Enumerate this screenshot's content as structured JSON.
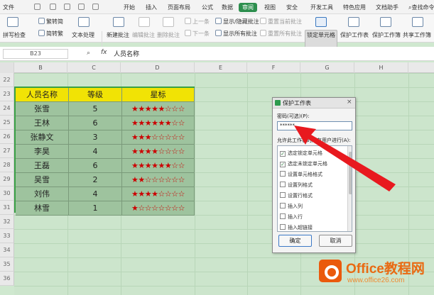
{
  "menu": {
    "items": [
      "文件",
      "开始",
      "插入",
      "页面布局",
      "公式",
      "数据",
      "审阅",
      "视图",
      "安全",
      "开发工具",
      "特色应用",
      "文档助手"
    ],
    "active": "审阅",
    "search": "查找命令",
    "file_label": "文件"
  },
  "ribbon": {
    "spellcheck": "拼写检查",
    "trad": "繁转简",
    "simp": "简转繁",
    "docproc": "文本处理",
    "new_comment": "新建批注",
    "edit_comment": "编辑批注",
    "del_comment": "删除批注",
    "prev": "上一条",
    "next": "下一条",
    "show_hide": "显示/隐藏批注",
    "show_all": "显示所有批注",
    "reset_cur": "重置当前批注",
    "reset_all": "重置所有批注",
    "lock_cell": "锁定单元格",
    "protect_sheet": "保护工作表",
    "protect_book": "保护工作簿",
    "share_book": "共享工作簿"
  },
  "formula": {
    "cellref": "B23",
    "fx": "fx",
    "value": "人员名称"
  },
  "columns": [
    "B",
    "C",
    "D",
    "E",
    "F",
    "G",
    "H"
  ],
  "rows": [
    "22",
    "23",
    "24",
    "25",
    "26",
    "27",
    "28",
    "29",
    "30",
    "31",
    "32",
    "33",
    "34",
    "35",
    "36"
  ],
  "table": {
    "headers": [
      "人员名称",
      "等级",
      "星标"
    ],
    "rows": [
      {
        "name": "张雪",
        "level": "5",
        "stars": "★★★★★☆☆☆"
      },
      {
        "name": "王林",
        "level": "6",
        "stars": "★★★★★★☆☆"
      },
      {
        "name": "张静文",
        "level": "3",
        "stars": "★★★☆☆☆☆☆"
      },
      {
        "name": "李昊",
        "level": "4",
        "stars": "★★★★☆☆☆☆"
      },
      {
        "name": "王磊",
        "level": "6",
        "stars": "★★★★★★☆☆"
      },
      {
        "name": "吴雪",
        "level": "2",
        "stars": "★★☆☆☆☆☆☆"
      },
      {
        "name": "刘伟",
        "level": "4",
        "stars": "★★★★☆☆☆☆"
      },
      {
        "name": "林雪",
        "level": "1",
        "stars": "★☆☆☆☆☆☆☆"
      }
    ]
  },
  "dialog": {
    "title": "保护工作表",
    "close": "×",
    "pw_label": "密码(可选)(P):",
    "pw_value": "******",
    "allow_label": "允许此工作表的所有用户进行(A):",
    "options": [
      {
        "label": "选定锁定单元格",
        "checked": true
      },
      {
        "label": "选定未锁定单元格",
        "checked": true
      },
      {
        "label": "设置单元格格式",
        "checked": false
      },
      {
        "label": "设置列格式",
        "checked": false
      },
      {
        "label": "设置行格式",
        "checked": false
      },
      {
        "label": "插入列",
        "checked": false
      },
      {
        "label": "插入行",
        "checked": false
      },
      {
        "label": "插入超链接",
        "checked": false
      }
    ],
    "ok": "确定",
    "cancel": "取消"
  },
  "watermark": {
    "brand": "Office教程网",
    "url": "www.office26.com"
  },
  "colors": {
    "accent": "#2d8f4e",
    "header_fill": "#f1e305",
    "body_fill": "#9ec39e",
    "star": "#cc0000",
    "arrow": "#e8191f"
  }
}
